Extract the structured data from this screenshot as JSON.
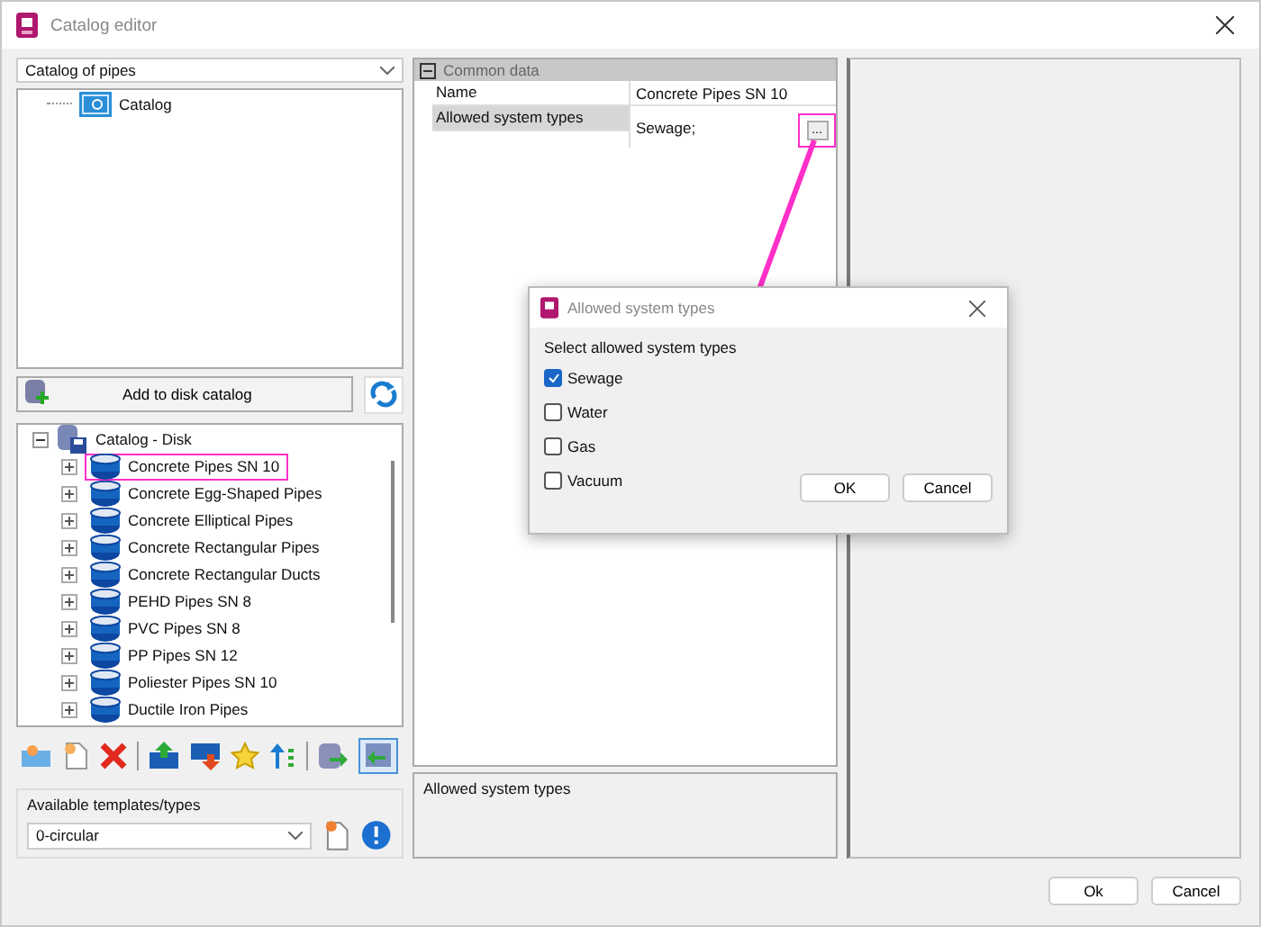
{
  "window": {
    "title": "Catalog editor"
  },
  "catalog_select": {
    "value": "Catalog of pipes"
  },
  "catalog_tree": [
    {
      "label": "Catalog"
    }
  ],
  "add_button": "Add to disk catalog",
  "disk_tree": {
    "label": "Catalog - Disk",
    "expanded": true,
    "children": [
      {
        "label": "Concrete Pipes SN 10",
        "highlighted": true
      },
      {
        "label": "Concrete Egg-Shaped Pipes",
        "highlighted": false
      },
      {
        "label": "Concrete Elliptical Pipes",
        "highlighted": false
      },
      {
        "label": "Concrete Rectangular Pipes",
        "highlighted": false
      },
      {
        "label": "Concrete Rectangular Ducts",
        "highlighted": false
      },
      {
        "label": "PEHD Pipes SN 8",
        "highlighted": false
      },
      {
        "label": "PVC Pipes SN 8",
        "highlighted": false
      },
      {
        "label": "PP Pipes SN 12",
        "highlighted": false
      },
      {
        "label": "Poliester Pipes SN 10",
        "highlighted": false
      },
      {
        "label": "Ductile Iron Pipes",
        "highlighted": false
      }
    ]
  },
  "templates": {
    "label": "Available templates/types",
    "value": "0-circular"
  },
  "properties": {
    "group": "Common data",
    "expanded": true,
    "rows": [
      {
        "name": "Name",
        "value": "Concrete Pipes SN 10"
      },
      {
        "name": "Allowed system types",
        "value": "Sewage;",
        "browse_label": "...",
        "highlighted": true
      }
    ]
  },
  "description": "Allowed system types",
  "buttons": [
    "Ok",
    "Cancel"
  ],
  "dialog": {
    "title": "Allowed system types",
    "prompt": "Select allowed system types",
    "options": [
      {
        "label": "Sewage",
        "checked": true
      },
      {
        "label": "Water",
        "checked": false
      },
      {
        "label": "Gas",
        "checked": false
      },
      {
        "label": "Vacuum",
        "checked": false
      }
    ],
    "buttons": [
      "OK",
      "Cancel"
    ]
  }
}
